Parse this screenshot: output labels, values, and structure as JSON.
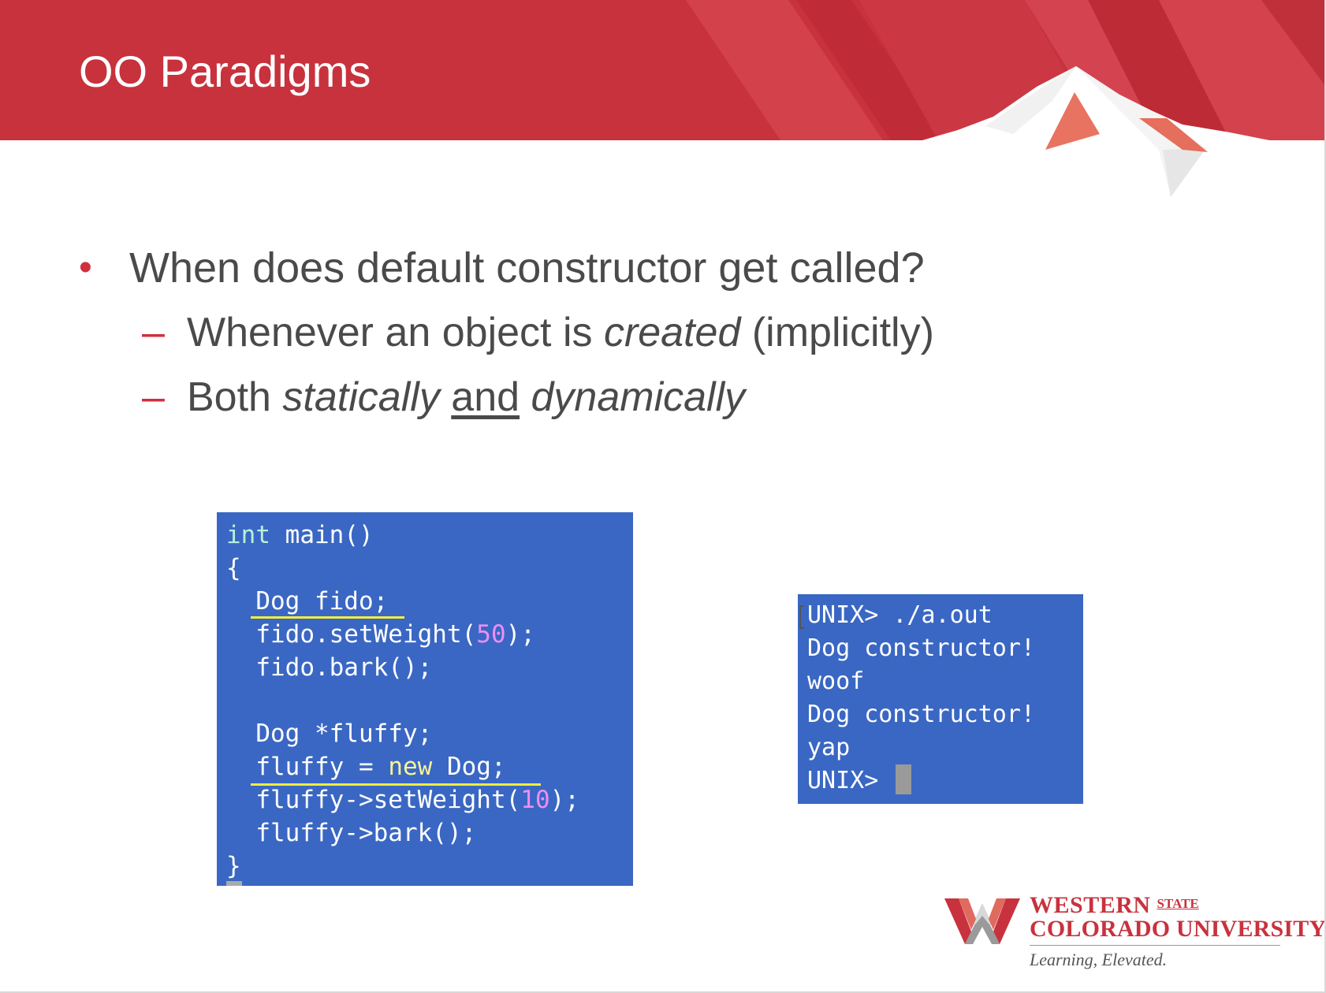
{
  "slide": {
    "title": "OO Paradigms",
    "brand_color": "#c8323e",
    "bullet": {
      "marker": "•",
      "text": "When does default constructor get called?"
    },
    "sub_bullets": [
      {
        "marker": "–",
        "parts": [
          "Whenever an object is ",
          "created",
          " (implicitly)"
        ]
      },
      {
        "marker": "–",
        "parts": [
          "Both ",
          "statically",
          " ",
          "and",
          " ",
          "dynamically"
        ]
      }
    ]
  },
  "code": {
    "background": "#3a67c3",
    "lines": [
      {
        "kind": "type",
        "segments": [
          "int",
          " main()"
        ]
      },
      {
        "kind": "plain",
        "segments": [
          "{"
        ]
      },
      {
        "kind": "plain",
        "segments": [
          "  Dog fido;"
        ]
      },
      {
        "kind": "num",
        "segments": [
          "  fido.setWeight(",
          "50",
          ");"
        ]
      },
      {
        "kind": "plain",
        "segments": [
          "  fido.bark();"
        ]
      },
      {
        "kind": "plain",
        "segments": [
          ""
        ]
      },
      {
        "kind": "plain",
        "segments": [
          "  Dog *fluffy;"
        ]
      },
      {
        "kind": "new",
        "segments": [
          "  fluffy = ",
          "new",
          " Dog;"
        ]
      },
      {
        "kind": "num",
        "segments": [
          "  fluffy->setWeight(",
          "10",
          ");"
        ]
      },
      {
        "kind": "plain",
        "segments": [
          "  fluffy->bark();"
        ]
      },
      {
        "kind": "plain",
        "segments": [
          "}"
        ]
      }
    ]
  },
  "terminal": {
    "background": "#3a67c3",
    "lines": [
      "UNIX> ./a.out",
      "Dog constructor!",
      "woof",
      "Dog constructor!",
      "yap",
      "UNIX> "
    ]
  },
  "logo": {
    "line1": "WESTERN",
    "state": "STATE",
    "line2": "COLORADO UNIVERSITY",
    "tagline": "Learning, Elevated."
  }
}
